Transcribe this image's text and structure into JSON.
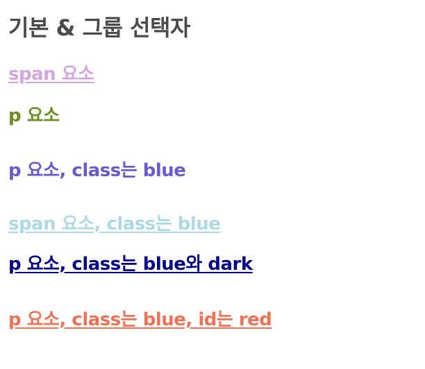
{
  "heading": "기본 & 그룹 선택자",
  "lines": [
    {
      "text": "span 요소",
      "color": "#d4a6e0",
      "underlined": true
    },
    {
      "text": "p 요소",
      "color": "#6b8e23",
      "underlined": false
    },
    {
      "text": "p 요소, class는 blue",
      "color": "#6a5acd",
      "underlined": false
    },
    {
      "text": "span 요소, class는 blue",
      "color": "#add8e6",
      "underlined": true
    },
    {
      "text": "p 요소, class는 blue와 dark",
      "color": "#00008b",
      "underlined": true
    },
    {
      "text": "p 요소, class는 blue, id는 red",
      "color": "#f07256",
      "underlined": true
    }
  ]
}
